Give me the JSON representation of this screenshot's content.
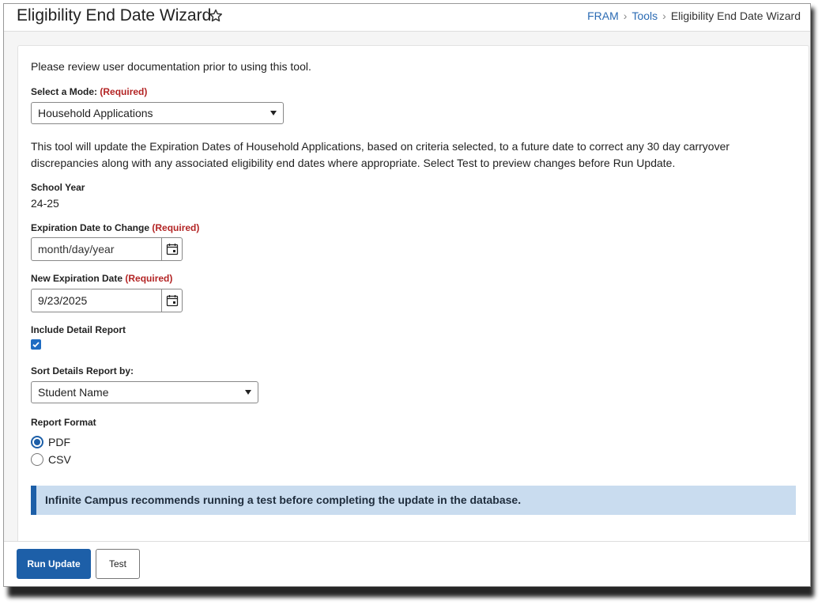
{
  "header": {
    "title": "Eligibility End Date Wizard",
    "breadcrumb": [
      "FRAM",
      "Tools",
      "Eligibility End Date Wizard"
    ]
  },
  "form": {
    "intro": "Please review user documentation prior to using this tool.",
    "required_text": "(Required)",
    "mode_label": "Select a Mode:",
    "mode_value": "Household Applications",
    "description": "This tool will update the Expiration Dates of Household Applications, based on criteria selected, to a future date to correct any 30 day carryover discrepancies along with any associated eligibility end dates where appropriate. Select Test to preview changes before Run Update.",
    "school_year_label": "School Year",
    "school_year_value": "24-25",
    "exp_date_label": "Expiration Date to Change",
    "exp_date_placeholder": "month/day/year",
    "new_exp_label": "New Expiration Date",
    "new_exp_value": "9/23/2025",
    "detail_report_label": "Include Detail Report",
    "detail_report_checked": true,
    "sort_label": "Sort Details Report by:",
    "sort_value": "Student Name",
    "format_label": "Report Format",
    "format_options": [
      "PDF",
      "CSV"
    ],
    "format_selected": "PDF",
    "notice": "Infinite Campus recommends running a test before completing the update in the database."
  },
  "footer": {
    "run_label": "Run Update",
    "test_label": "Test"
  },
  "colors": {
    "primary": "#1d5fa8",
    "required": "#b32424",
    "notice_bg": "#c9dcef",
    "link": "#2a6ab3"
  }
}
